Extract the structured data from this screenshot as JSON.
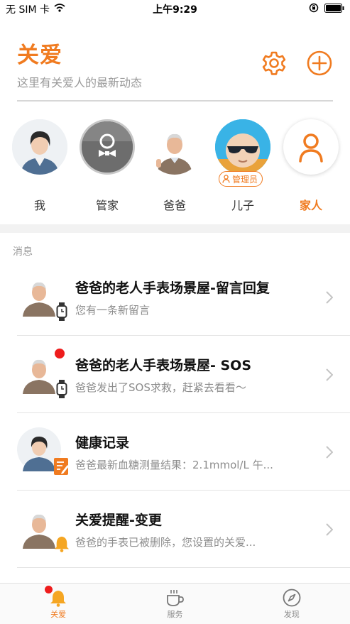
{
  "status": {
    "carrier": "无 SIM 卡",
    "time": "上午9:29"
  },
  "header": {
    "title": "关爱",
    "subtitle": "这里有关爱人的最新动态"
  },
  "members": [
    {
      "label": "我",
      "active": false
    },
    {
      "label": "管家",
      "active": false
    },
    {
      "label": "爸爸",
      "active": false
    },
    {
      "label": "儿子",
      "active": false,
      "badge": "管理员"
    },
    {
      "label": "家人",
      "active": true
    }
  ],
  "section": {
    "title": "消息"
  },
  "messages": [
    {
      "title": "爸爸的老人手表场景屋-留言回复",
      "subtitle": "您有一条新留言",
      "icon": "watch-icon",
      "unread": false
    },
    {
      "title": "爸爸的老人手表场景屋- SOS",
      "subtitle": "爸爸发出了SOS求救，赶紧去看看～",
      "icon": "watch-icon",
      "unread": true
    },
    {
      "title": "健康记录",
      "subtitle": "爸爸最新血糖测量结果：2.1mmol/L 午...",
      "icon": "record-icon",
      "unread": false
    },
    {
      "title": "关爱提醒-变更",
      "subtitle": "爸爸的手表已被删除，您设置的关爱...",
      "icon": "bell-icon",
      "unread": false
    }
  ],
  "tabs": [
    {
      "label": "关爱",
      "icon": "bell-icon",
      "active": true
    },
    {
      "label": "服务",
      "icon": "coffee-icon",
      "active": false
    },
    {
      "label": "发现",
      "icon": "compass-icon",
      "active": false
    }
  ],
  "colors": {
    "accent": "#f07b20",
    "unread": "#ee1c1c"
  }
}
